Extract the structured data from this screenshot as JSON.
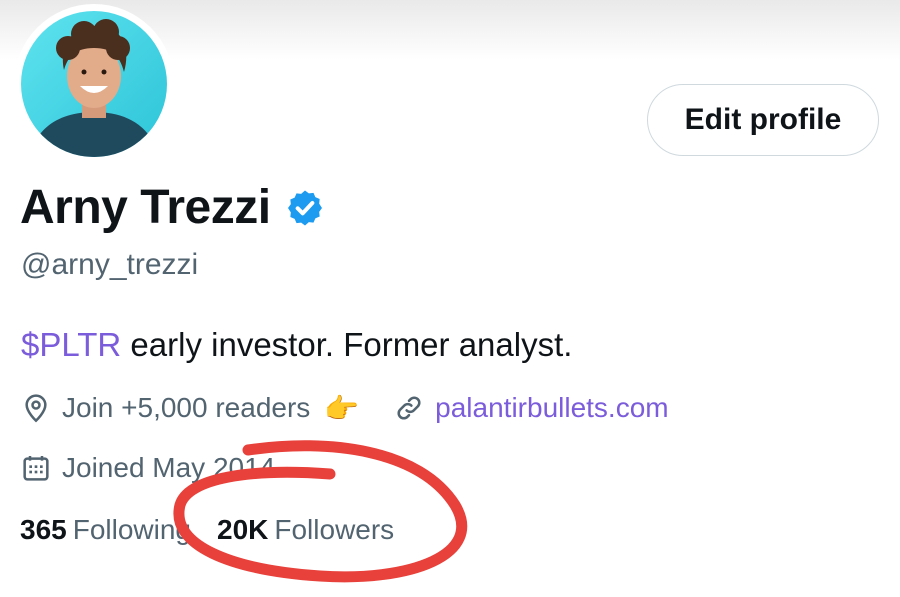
{
  "profile": {
    "name": "Arny Trezzi",
    "handle": "@arny_trezzi",
    "verified_icon": "verified-badge-icon",
    "edit_button": "Edit profile",
    "bio": {
      "cashtag": "$PLTR",
      "text": " early investor. Former analyst."
    },
    "location": {
      "icon": "location-pin-icon",
      "text": "Join +5,000 readers",
      "emoji": "👉"
    },
    "website": {
      "icon": "link-icon",
      "text": "palantirbullets.com"
    },
    "joined": {
      "icon": "calendar-icon",
      "text": "Joined May 2014"
    },
    "stats": {
      "following_count": "365",
      "following_label": "Following",
      "followers_count": "20K",
      "followers_label": "Followers"
    }
  },
  "colors": {
    "accent": "#7b5cdb",
    "verified": "#1d9bf0",
    "secondary_text": "#536471",
    "annotation": "#e8403a",
    "avatar_bg": "#3ed3e3"
  }
}
